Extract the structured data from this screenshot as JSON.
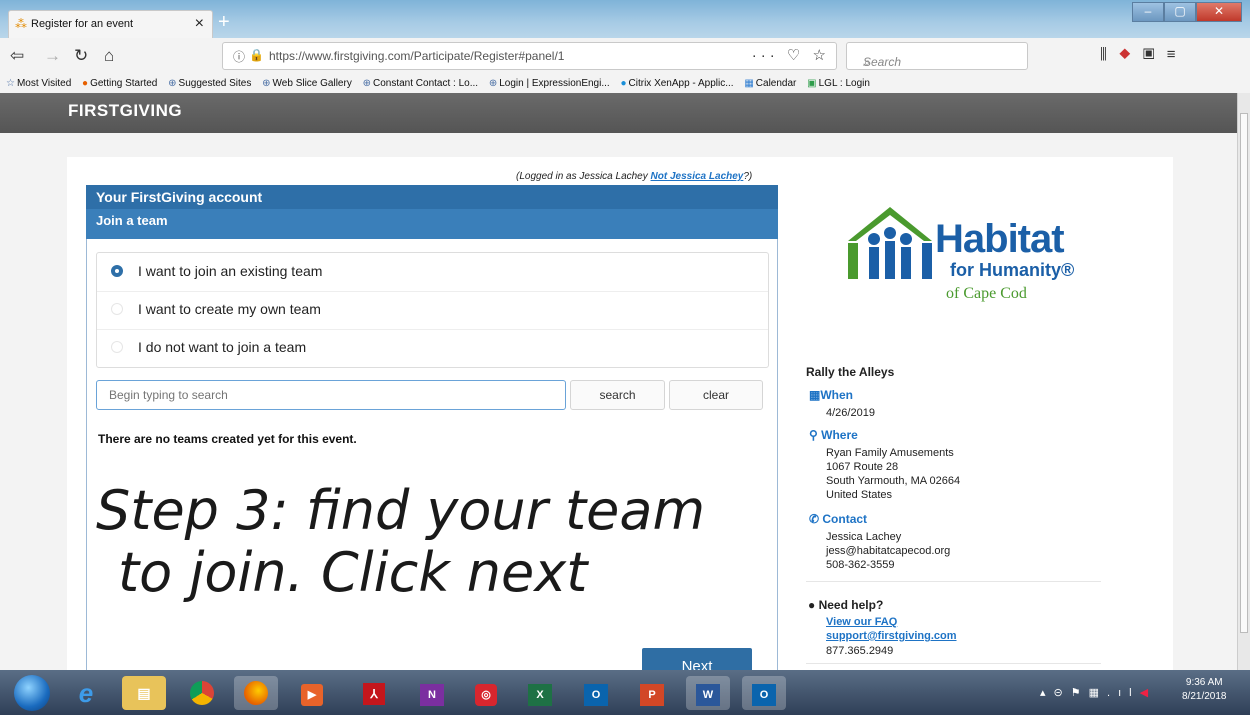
{
  "browser": {
    "tab_title": "Register for an event",
    "url": "https://www.firstgiving.com/Participate/Register#panel/1",
    "search_placeholder": "Search",
    "bookmarks": [
      "Most Visited",
      "Getting Started",
      "Suggested Sites",
      "Web Slice Gallery",
      "Constant Contact : Lo...",
      "Login | ExpressionEngi...",
      "Citrix XenApp - Applic...",
      "Calendar",
      "LGL : Login"
    ]
  },
  "site": {
    "logo": "FIRSTGIVING"
  },
  "login": {
    "prefix": "(Logged in as Jessica Lachey",
    "link": "Not Jessica Lachey",
    "suffix": "?)"
  },
  "panel": {
    "header1": "Your FirstGiving account",
    "header2": "Join a team",
    "options": [
      "I want to join an existing team",
      "I want to create my own team",
      "I do not want to join a team"
    ],
    "selected_option": 0,
    "search_placeholder": "Begin typing to search",
    "search_button": "search",
    "clear_button": "clear",
    "no_teams_text": "There are no teams created yet for this event.",
    "next_button": "Next"
  },
  "annotation": {
    "line1": "Step 3: find your team",
    "line2": "to join. Click next"
  },
  "sidebar": {
    "org_name": "Habitat",
    "org_sub1": "for Humanity®",
    "org_sub2": "of Cape Cod",
    "event_name": "Rally the Alleys",
    "when_label": "When",
    "when_value": "4/26/2019",
    "where_label": "Where",
    "where_lines": [
      "Ryan Family Amusements",
      "1067 Route 28",
      "South Yarmouth, MA 02664",
      "United States"
    ],
    "contact_label": "Contact",
    "contact_lines": [
      "Jessica Lachey",
      "jess@habitatcapecod.org",
      "508-362-3559"
    ],
    "help_label": "Need help?",
    "faq_link": "View our FAQ",
    "support_link": "support@firstgiving.com",
    "support_phone": "877.365.2949"
  },
  "taskbar": {
    "time": "9:36 AM",
    "date": "8/21/2018"
  },
  "colors": {
    "header_blue": "#2e6fa8",
    "link_blue": "#1e73c5",
    "habitat_blue": "#1b5fa7",
    "habitat_green": "#4a9a2e"
  }
}
